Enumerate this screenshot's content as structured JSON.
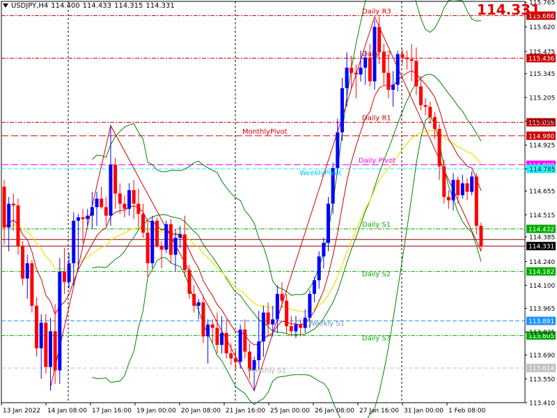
{
  "header": {
    "symbol": "USDJPY,H4",
    "open": "114.400",
    "high": "114.433",
    "low": "114.315",
    "close": "114.331",
    "last_price": "114.331"
  },
  "colors": {
    "background": "#ffffff",
    "bull": "#0000ff",
    "bear": "#ff0000",
    "bb_band": "#008000",
    "ma_fast": "#cc0000",
    "ma_slow": "#ffff00",
    "zigzag": "#cc0000",
    "pivot_daily": "#cc0000",
    "pivot_weekly": "#ff00ff",
    "pivot_monthly": "#cc0000",
    "support_daily": "#00aa00",
    "support_weekly": "#1e90ff",
    "support_monthly": "#c0c0c0"
  },
  "chart_data": {
    "type": "candlestick",
    "symbol": "USDJPY",
    "timeframe": "H4",
    "ylim": [
      113.41,
      115.77
    ],
    "y_ticks": [
      "115.765",
      "115.620",
      "115.475",
      "115.345",
      "115.205",
      "115.065",
      "114.925",
      "114.785",
      "114.655",
      "114.515",
      "114.385",
      "114.240",
      "114.100",
      "113.965",
      "113.825",
      "113.690",
      "113.550",
      "113.410"
    ],
    "x_ticks": [
      "13 Jan 2022",
      "14 Jan 08:00",
      "17 Jan 16:00",
      "19 Jan 00:00",
      "20 Jan 08:00",
      "21 Jan 16:00",
      "25 Jan 00:00",
      "26 Jan 08:00",
      "27 Jan 16:00",
      "31 Jan 00:00",
      "1 Feb 08:00"
    ],
    "grid": false,
    "candles": [
      [
        114.68,
        114.72,
        114.34,
        114.44
      ],
      [
        114.44,
        114.62,
        114.3,
        114.58
      ],
      [
        114.58,
        114.64,
        114.42,
        114.57
      ],
      [
        114.57,
        114.61,
        114.28,
        114.33
      ],
      [
        114.33,
        114.36,
        114.1,
        114.14
      ],
      [
        114.14,
        114.28,
        114.02,
        114.23
      ],
      [
        114.23,
        114.25,
        113.94,
        113.98
      ],
      [
        113.98,
        114.03,
        113.68,
        113.73
      ],
      [
        113.73,
        113.93,
        113.55,
        113.88
      ],
      [
        113.88,
        113.93,
        113.58,
        113.62
      ],
      [
        113.62,
        113.91,
        113.48,
        113.83
      ],
      [
        113.83,
        113.99,
        113.52,
        113.6
      ],
      [
        113.6,
        114.26,
        113.52,
        114.18
      ],
      [
        114.18,
        114.32,
        114.05,
        114.12
      ],
      [
        114.12,
        114.29,
        114.08,
        114.23
      ],
      [
        114.23,
        114.53,
        114.1,
        114.48
      ],
      [
        114.48,
        114.52,
        114.2,
        114.5
      ],
      [
        114.5,
        114.55,
        114.35,
        114.49
      ],
      [
        114.49,
        114.55,
        114.45,
        114.51
      ],
      [
        114.51,
        114.65,
        114.43,
        114.56
      ],
      [
        114.56,
        114.65,
        114.45,
        114.61
      ],
      [
        114.61,
        114.68,
        114.55,
        114.56
      ],
      [
        114.56,
        114.62,
        114.45,
        114.51
      ],
      [
        114.51,
        115.04,
        114.45,
        114.81
      ],
      [
        114.81,
        114.85,
        114.55,
        114.64
      ],
      [
        114.64,
        114.7,
        114.52,
        114.58
      ],
      [
        114.58,
        114.63,
        114.5,
        114.55
      ],
      [
        114.55,
        114.7,
        114.51,
        114.66
      ],
      [
        114.66,
        114.72,
        114.49,
        114.58
      ],
      [
        114.58,
        114.67,
        114.44,
        114.52
      ],
      [
        114.52,
        114.58,
        114.38,
        114.41
      ],
      [
        114.41,
        114.48,
        114.15,
        114.23
      ],
      [
        114.23,
        114.51,
        114.2,
        114.48
      ],
      [
        114.48,
        114.5,
        114.32,
        114.33
      ],
      [
        114.33,
        114.36,
        114.2,
        114.31
      ],
      [
        114.31,
        114.48,
        114.29,
        114.46
      ],
      [
        114.46,
        114.49,
        114.23,
        114.28
      ],
      [
        114.28,
        114.43,
        114.18,
        114.38
      ],
      [
        114.38,
        114.45,
        114.32,
        114.4
      ],
      [
        114.4,
        114.51,
        114.15,
        114.19
      ],
      [
        114.19,
        114.22,
        114.02,
        114.05
      ],
      [
        114.05,
        114.1,
        113.94,
        113.98
      ],
      [
        113.98,
        114.02,
        113.9,
        114.0
      ],
      [
        114.0,
        114.04,
        113.76,
        113.8
      ],
      [
        113.8,
        113.9,
        113.64,
        113.87
      ],
      [
        113.87,
        113.9,
        113.76,
        113.85
      ],
      [
        113.85,
        113.94,
        113.7,
        113.75
      ],
      [
        113.75,
        113.92,
        113.7,
        113.82
      ],
      [
        113.82,
        113.9,
        113.67,
        113.7
      ],
      [
        113.7,
        113.76,
        113.63,
        113.67
      ],
      [
        113.67,
        113.72,
        113.6,
        113.65
      ],
      [
        113.65,
        113.87,
        113.61,
        113.84
      ],
      [
        113.84,
        113.9,
        113.67,
        113.71
      ],
      [
        113.71,
        113.76,
        113.55,
        113.6
      ],
      [
        113.6,
        113.68,
        113.48,
        113.66
      ],
      [
        113.66,
        113.95,
        113.6,
        113.77
      ],
      [
        113.77,
        113.98,
        113.68,
        113.94
      ],
      [
        113.94,
        114.0,
        113.8,
        113.87
      ],
      [
        113.87,
        113.98,
        113.8,
        113.9
      ],
      [
        113.9,
        114.1,
        113.82,
        114.05
      ],
      [
        114.05,
        114.12,
        113.97,
        114.01
      ],
      [
        114.01,
        114.05,
        113.82,
        113.86
      ],
      [
        113.86,
        113.92,
        113.8,
        113.83
      ],
      [
        113.83,
        113.92,
        113.79,
        113.87
      ],
      [
        113.87,
        113.9,
        113.8,
        113.85
      ],
      [
        113.85,
        113.96,
        113.82,
        113.91
      ],
      [
        113.91,
        114.07,
        113.85,
        114.05
      ],
      [
        114.05,
        114.15,
        114.0,
        114.13
      ],
      [
        114.13,
        114.3,
        114.08,
        114.27
      ],
      [
        114.27,
        114.38,
        114.2,
        114.35
      ],
      [
        114.35,
        114.62,
        114.3,
        114.58
      ],
      [
        114.58,
        114.82,
        114.52,
        114.79
      ],
      [
        114.79,
        115.08,
        114.76,
        115.0
      ],
      [
        115.0,
        115.32,
        114.95,
        115.26
      ],
      [
        115.26,
        115.47,
        115.15,
        115.38
      ],
      [
        115.38,
        115.45,
        115.26,
        115.35
      ],
      [
        115.35,
        115.4,
        115.2,
        115.34
      ],
      [
        115.34,
        115.48,
        115.3,
        115.38
      ],
      [
        115.38,
        115.48,
        115.28,
        115.44
      ],
      [
        115.44,
        115.52,
        115.27,
        115.3
      ],
      [
        115.3,
        115.66,
        115.25,
        115.62
      ],
      [
        115.62,
        115.68,
        115.4,
        115.47
      ],
      [
        115.47,
        115.52,
        115.28,
        115.35
      ],
      [
        115.35,
        115.45,
        115.2,
        115.25
      ],
      [
        115.25,
        115.36,
        115.15,
        115.28
      ],
      [
        115.28,
        115.48,
        115.24,
        115.46
      ],
      [
        115.46,
        115.49,
        115.4,
        115.44
      ],
      [
        115.44,
        115.48,
        115.37,
        115.43
      ],
      [
        115.43,
        115.52,
        115.3,
        115.42
      ],
      [
        115.42,
        115.5,
        115.22,
        115.27
      ],
      [
        115.27,
        115.33,
        115.13,
        115.16
      ],
      [
        115.16,
        115.2,
        115.1,
        115.15
      ],
      [
        115.15,
        115.18,
        115.05,
        115.09
      ],
      [
        115.09,
        115.12,
        114.96,
        115.02
      ],
      [
        115.02,
        115.05,
        114.72,
        114.8
      ],
      [
        114.8,
        114.84,
        114.58,
        114.62
      ],
      [
        114.62,
        114.66,
        114.55,
        114.6
      ],
      [
        114.6,
        114.76,
        114.54,
        114.72
      ],
      [
        114.72,
        114.74,
        114.58,
        114.63
      ],
      [
        114.63,
        114.75,
        114.61,
        114.7
      ],
      [
        114.7,
        114.73,
        114.6,
        114.65
      ],
      [
        114.65,
        114.77,
        114.63,
        114.74
      ],
      [
        114.74,
        114.76,
        114.4,
        114.45
      ],
      [
        114.45,
        114.47,
        114.3,
        114.33
      ]
    ],
    "levels": [
      {
        "label": "Daily R3",
        "value": 115.686,
        "price_label": "115.686",
        "kind": "daily-resistance"
      },
      {
        "label": "Daily R2",
        "value": 115.436,
        "price_label": "115.436",
        "kind": "daily-resistance"
      },
      {
        "label": "Daily R1",
        "value": 115.059,
        "price_label": "115.059",
        "kind": "daily-resistance"
      },
      {
        "label": "MonthlyPivot",
        "value": 114.98,
        "price_label": "114.980",
        "kind": "monthly-pivot"
      },
      {
        "label": "Daily Pivot",
        "value": 114.809,
        "price_label": "114.809",
        "kind": "daily-pivot"
      },
      {
        "label": "WeeklyPivot",
        "value": 114.785,
        "price_label": "114.785",
        "kind": "weekly-pivot"
      },
      {
        "label": "Daily S1",
        "value": 114.432,
        "price_label": "114.432",
        "kind": "daily-support"
      },
      {
        "label": "Daily S2",
        "value": 114.182,
        "price_label": "114.182",
        "kind": "daily-support"
      },
      {
        "label": "Weekly S1",
        "value": 113.891,
        "price_label": "113.891",
        "kind": "weekly-support"
      },
      {
        "label": "Daily S3",
        "value": 113.805,
        "price_label": "113.805",
        "kind": "daily-support"
      },
      {
        "label": "Monthly S1",
        "value": 113.614,
        "price_label": "113.614",
        "kind": "monthly-support"
      }
    ],
    "current_price": {
      "value": 114.331,
      "price_label": "114.331"
    }
  }
}
